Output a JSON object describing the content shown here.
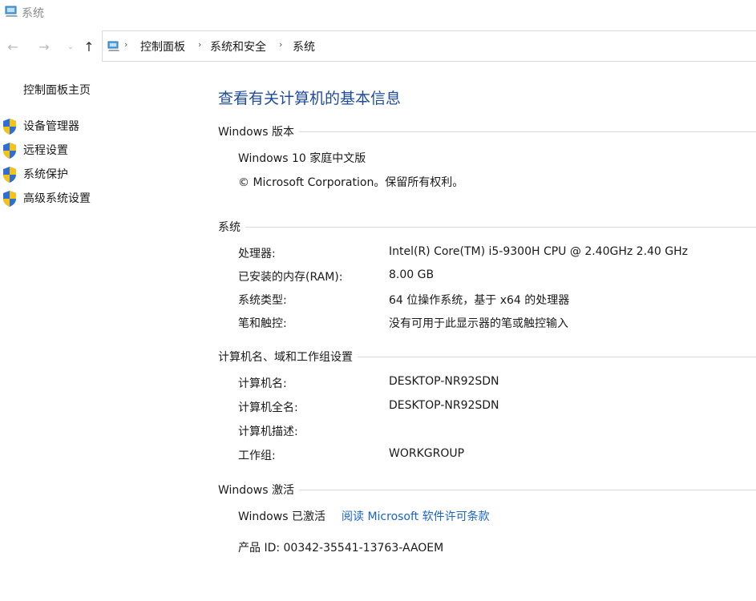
{
  "window": {
    "title": "系统",
    "icon": "system-computer-icon"
  },
  "nav": {
    "back_icon": "arrow-left-icon",
    "forward_icon": "arrow-right-icon",
    "recent_icon": "chevron-down-icon",
    "up_icon": "arrow-up-icon",
    "breadcrumb": [
      "控制面板",
      "系统和安全",
      "系统"
    ]
  },
  "sidebar": {
    "home": "控制面板主页",
    "links": [
      {
        "label": "设备管理器",
        "icon": "uac-shield-icon"
      },
      {
        "label": "远程设置",
        "icon": "uac-shield-icon"
      },
      {
        "label": "系统保护",
        "icon": "uac-shield-icon"
      },
      {
        "label": "高级系统设置",
        "icon": "uac-shield-icon"
      }
    ]
  },
  "main": {
    "title": "查看有关计算机的基本信息",
    "edition": {
      "header": "Windows 版本",
      "name": "Windows 10 家庭中文版",
      "copyright": "© Microsoft Corporation。保留所有权利。"
    },
    "system": {
      "header": "系统",
      "rows": [
        {
          "label": "处理器:",
          "value": "Intel(R) Core(TM) i5-9300H CPU @ 2.40GHz   2.40 GHz"
        },
        {
          "label": "已安装的内存(RAM):",
          "value": "8.00 GB"
        },
        {
          "label": "系统类型:",
          "value": "64 位操作系统，基于 x64 的处理器"
        },
        {
          "label": "笔和触控:",
          "value": "没有可用于此显示器的笔或触控输入"
        }
      ]
    },
    "computer": {
      "header": "计算机名、域和工作组设置",
      "rows": [
        {
          "label": "计算机名:",
          "value": "DESKTOP-NR92SDN"
        },
        {
          "label": "计算机全名:",
          "value": "DESKTOP-NR92SDN"
        },
        {
          "label": "计算机描述:",
          "value": ""
        },
        {
          "label": "工作组:",
          "value": "WORKGROUP"
        }
      ]
    },
    "activation": {
      "header": "Windows 激活",
      "status": "Windows 已激活",
      "license_link": "阅读 Microsoft 软件许可条款",
      "product_id": "产品 ID: 00342-35541-13763-AAOEM"
    }
  },
  "colors": {
    "title": "#1f4b9b",
    "link": "#1a64c8",
    "divider": "#dadada"
  }
}
